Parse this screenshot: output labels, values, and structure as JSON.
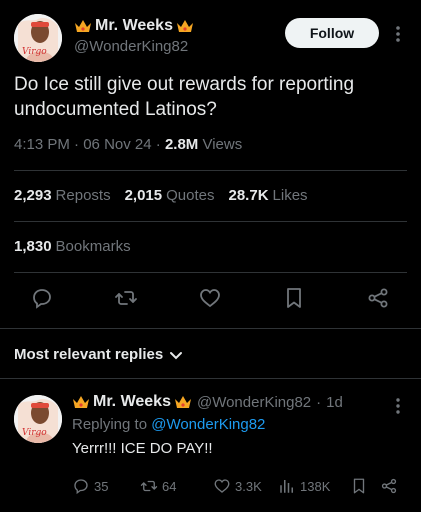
{
  "post": {
    "display_name": "Mr. Weeks",
    "handle": "@WonderKing82",
    "follow_label": "Follow",
    "text": "Do Ice still give out rewards for reporting undocumented Latinos?",
    "time": "4:13 PM",
    "date": "06 Nov 24",
    "views_count": "2.8M",
    "views_label": "Views",
    "avatar_text": "Virgo"
  },
  "stats": {
    "reposts_count": "2,293",
    "reposts_label": "Reposts",
    "quotes_count": "2,015",
    "quotes_label": "Quotes",
    "likes_count": "28.7K",
    "likes_label": "Likes",
    "bookmarks_count": "1,830",
    "bookmarks_label": "Bookmarks"
  },
  "actions": [
    "reply-icon",
    "repost-icon",
    "like-icon",
    "bookmark-icon",
    "share-icon"
  ],
  "replies_filter": "Most relevant replies",
  "reply": {
    "display_name": "Mr. Weeks",
    "handle": "@WonderKing82",
    "age": "1d",
    "replying_prefix": "Replying to",
    "replying_to": "@WonderKing82",
    "text": "Yerrr!!! ICE DO PAY!!",
    "replies": "35",
    "reposts": "64",
    "likes": "3.3K",
    "views": "138K",
    "avatar_text": "Virgo"
  },
  "colors": {
    "background": "#000000",
    "text": "#e7e9ea",
    "muted": "#71767b",
    "link": "#1d9bf0",
    "divider": "#2f3336",
    "crown": "#f5a623"
  }
}
